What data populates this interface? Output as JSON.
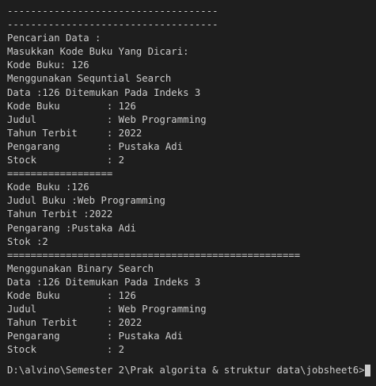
{
  "terminal": {
    "lines": [
      "------------------------------------",
      "------------------------------------",
      "Pencarian Data :",
      "Masukkan Kode Buku Yang Dicari:",
      "Kode Buku: 126",
      "Menggunakan Sequntial Search",
      "Data :126 Ditemukan Pada Indeks 3",
      "Kode Buku        : 126",
      "Judul            : Web Programming",
      "Tahun Terbit     : 2022",
      "Pengarang        : Pustaka Adi",
      "Stock            : 2",
      "==================",
      "Kode Buku :126",
      "Judul Buku :Web Programming",
      "Tahun Terbit :2022",
      "Pengarang :Pustaka Adi",
      "Stok :2",
      "==================================================",
      "Menggunakan Binary Search",
      "Data :126 Ditemukan Pada Indeks 3",
      "Kode Buku        : 126",
      "Judul            : Web Programming",
      "Tahun Terbit     : 2022",
      "Pengarang        : Pustaka Adi",
      "Stock            : 2",
      ""
    ],
    "prompt": "D:\\alvino\\Semester 2\\Prak algorita & struktur data\\jobsheet6>"
  }
}
